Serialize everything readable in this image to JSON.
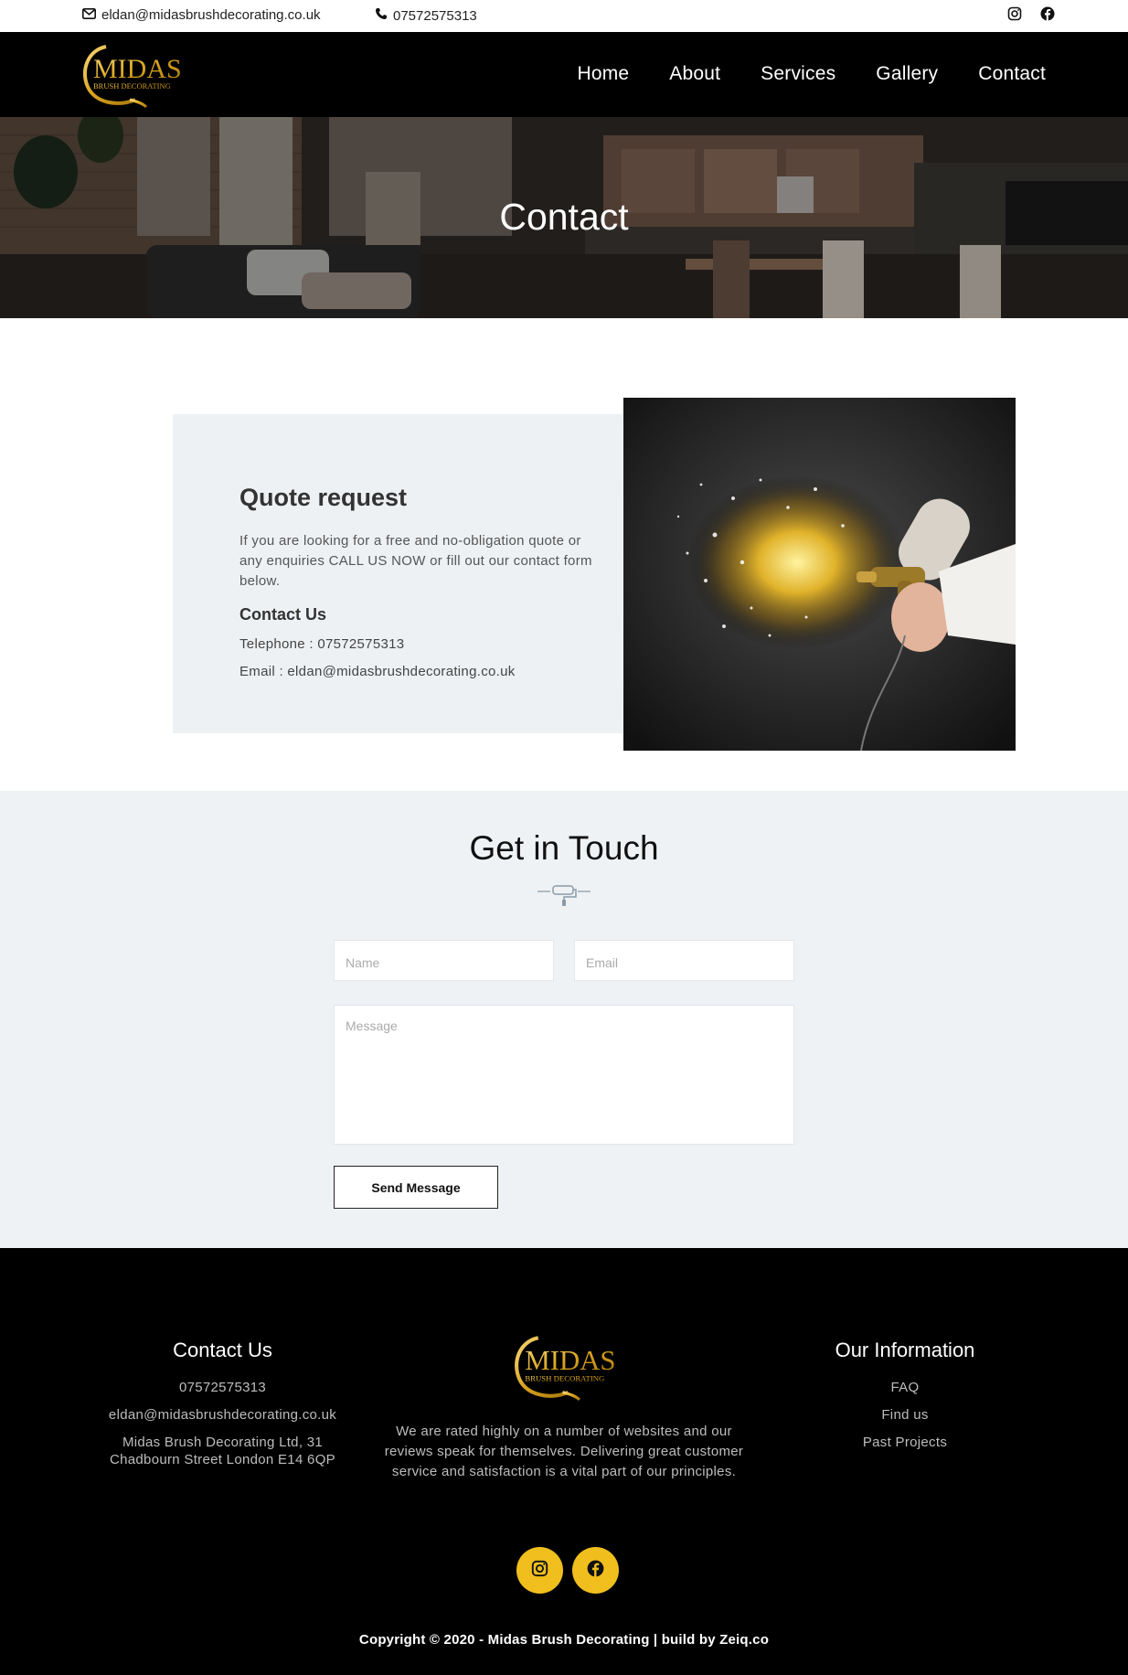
{
  "topbar": {
    "email": "eldan@midasbrushdecorating.co.uk",
    "phone": "07572575313",
    "icons": [
      "envelope-icon",
      "phone-icon",
      "instagram-icon",
      "facebook-icon"
    ]
  },
  "nav": {
    "logo_text": "MIDAS",
    "logo_subtext": "BRUSH DECORATING",
    "items": [
      {
        "label": "Home"
      },
      {
        "label": "About"
      },
      {
        "label": "Services"
      },
      {
        "label": "Gallery"
      },
      {
        "label": "Contact"
      }
    ]
  },
  "hero": {
    "title": "Contact"
  },
  "quote": {
    "title": "Quote request",
    "description": "If you are looking for a free and no-obligation quote or any enquiries CALL US NOW or fill out our contact form below.",
    "contact_title": "Contact Us",
    "telephone": "Telephone : 07572575313",
    "email": "Email : eldan@midasbrushdecorating.co.uk"
  },
  "touch": {
    "title": "Get in Touch",
    "name_placeholder": "Name",
    "email_placeholder": "Email",
    "message_placeholder": "Message",
    "send_label": "Send Message"
  },
  "footer": {
    "contact": {
      "title": "Contact Us",
      "phone": "07572575313",
      "email": "eldan@midasbrushdecorating.co.uk",
      "address": "Midas Brush Decorating Ltd, 31 Chadbourn Street London E14 6QP"
    },
    "logo_text": "MIDAS",
    "logo_subtext": "BRUSH DECORATING",
    "about": "We are rated highly on a number of websites and our reviews speak for themselves. Delivering great customer service and satisfaction is a vital part of our principles.",
    "info": {
      "title": "Our Information",
      "links": [
        {
          "label": "FAQ"
        },
        {
          "label": "Find us"
        },
        {
          "label": "Past Projects"
        }
      ]
    },
    "copyright": "Copyright © 2020 - Midas Brush Decorating | build by Zeiq.co"
  },
  "colors": {
    "gold": "#f0bf1d",
    "black": "#000000",
    "light_panel": "#eef1f4"
  }
}
